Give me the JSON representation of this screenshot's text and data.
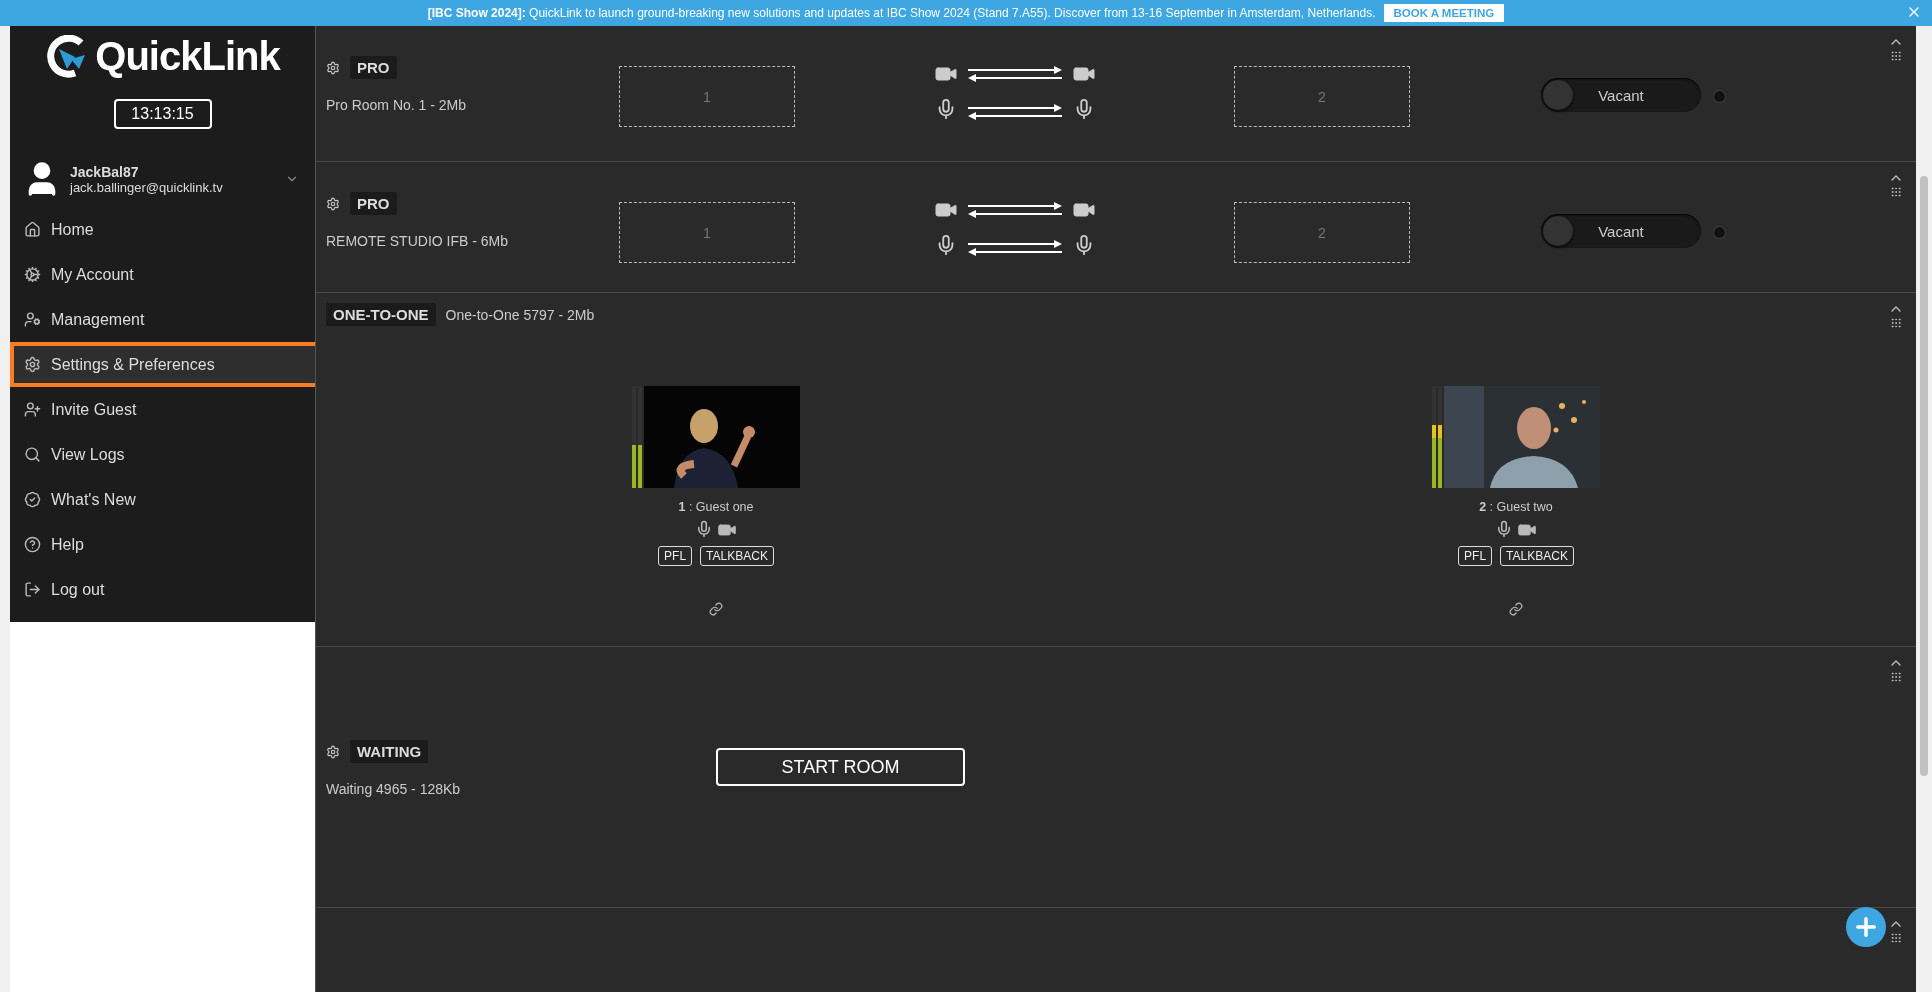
{
  "banner": {
    "message": "**[IBC Show 2024]:** QuickLink to launch ground-breaking new solutions and updates at IBC Show 2024 (Stand 7.A55). Discover from 13-16 September in Amsterdam, Netherlands.",
    "button": "BOOK A MEETING"
  },
  "sidebar": {
    "logo": "QuickLink",
    "clock": "13:13:15",
    "user": {
      "name": "JackBal87",
      "email": "jack.ballinger@quicklink.tv"
    },
    "items": [
      {
        "label": "Home",
        "selected": false
      },
      {
        "label": "My Account",
        "selected": false
      },
      {
        "label": "Management",
        "selected": false
      },
      {
        "label": "Settings & Preferences",
        "selected": true
      },
      {
        "label": "Invite Guest",
        "selected": false
      },
      {
        "label": "View Logs",
        "selected": false
      },
      {
        "label": "What's New",
        "selected": false
      },
      {
        "label": "Help",
        "selected": false
      },
      {
        "label": "Log out",
        "selected": false
      }
    ]
  },
  "rooms": [
    {
      "kind": "pro",
      "tag": "PRO",
      "name": "Pro Room No. 1 - 2Mb",
      "slots": [
        "1",
        "2"
      ],
      "status": "Vacant",
      "on": false
    },
    {
      "kind": "pro",
      "tag": "PRO",
      "name": "REMOTE STUDIO IFB - 6Mb",
      "slots": [
        "1",
        "2"
      ],
      "status": "Vacant",
      "on": false
    },
    {
      "kind": "one_to_one",
      "tag": "ONE-TO-ONE",
      "name": "One-to-One 5797 - 2Mb",
      "guests": [
        {
          "label": "**1** : Guest one",
          "level": 0.42,
          "buttons": [
            "PFL",
            "TALKBACK"
          ]
        },
        {
          "label": "**2** : Guest two",
          "level": 0.62,
          "buttons": [
            "PFL",
            "TALKBACK"
          ]
        }
      ]
    },
    {
      "kind": "waiting",
      "tag": "WAITING",
      "name": "Waiting 4965 - 128Kb",
      "button": "START ROOM"
    },
    {
      "kind": "empty"
    }
  ]
}
